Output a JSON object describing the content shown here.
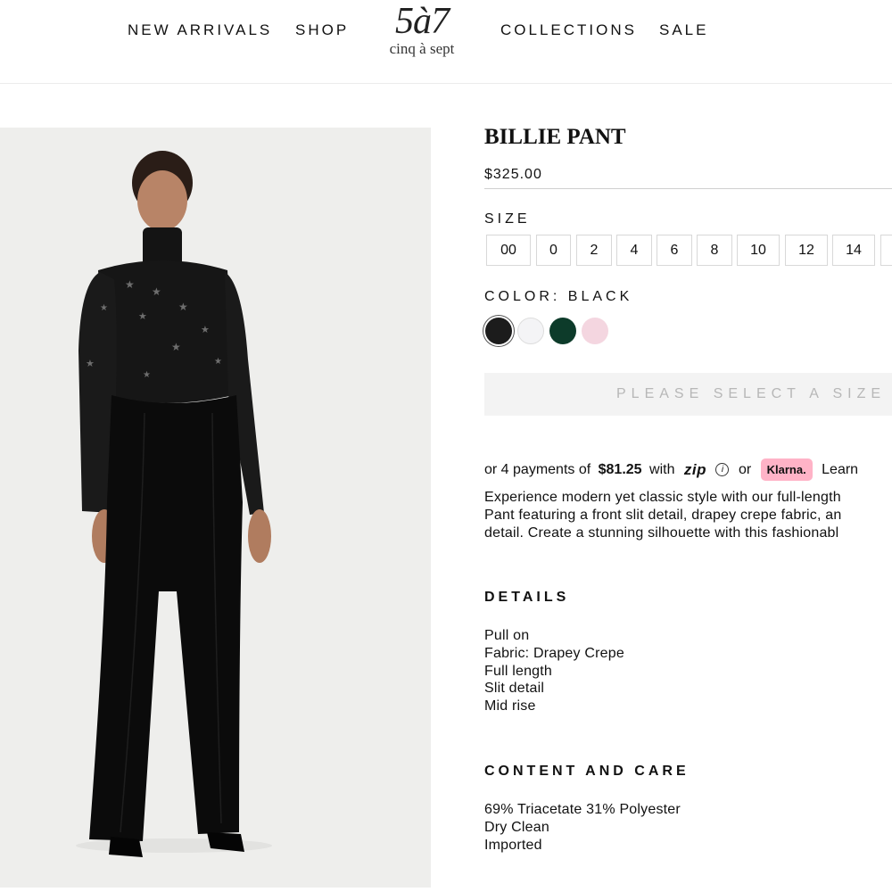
{
  "header": {
    "nav_left": [
      "NEW ARRIVALS",
      "SHOP"
    ],
    "nav_right": [
      "COLLECTIONS",
      "SALE"
    ],
    "logo": {
      "mark": "5à7",
      "text": "cinq à sept"
    }
  },
  "product": {
    "title": "BILLIE PANT",
    "price": "$325.00",
    "size_label": "SIZE",
    "sizes": [
      "00",
      "0",
      "2",
      "4",
      "6",
      "8",
      "10",
      "12",
      "14"
    ],
    "color_label": "COLOR: BLACK",
    "colors": [
      {
        "name": "Black",
        "hex": "#1c1c1c",
        "selected": true
      },
      {
        "name": "White",
        "hex": "#f4f4f6",
        "selected": false
      },
      {
        "name": "Green",
        "hex": "#0d3b2a",
        "selected": false
      },
      {
        "name": "Pink",
        "hex": "#f4d6e0",
        "selected": false
      }
    ],
    "add_button": "PLEASE SELECT A SIZE",
    "payments": {
      "prefix": "or 4 payments of",
      "amount": "$81.25",
      "with": "with",
      "zip": "zip",
      "or": "or",
      "klarna": "Klarna.",
      "learn": "Learn"
    },
    "description": [
      "Experience modern yet classic style with our full-length",
      "Pant featuring a front slit detail, drapey crepe fabric, an",
      "detail. Create a stunning silhouette with this fashionabl"
    ],
    "details_title": "DETAILS",
    "details": [
      "Pull on",
      "Fabric: Drapey Crepe",
      "Full length",
      "Slit detail",
      "Mid rise"
    ],
    "care_title": "CONTENT AND CARE",
    "care": [
      "69% Triacetate 31% Polyester",
      "Dry Clean",
      "Imported"
    ]
  }
}
